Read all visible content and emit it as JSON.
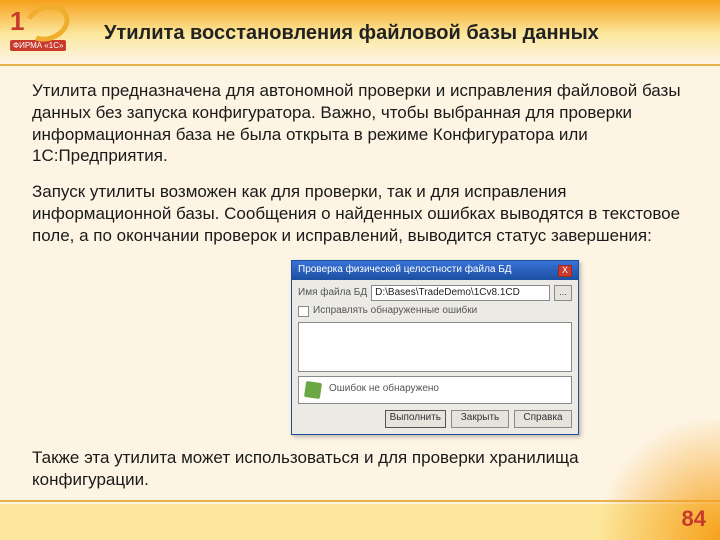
{
  "logo": {
    "brand": "ФИРМА «1С»"
  },
  "title": "Утилита восстановления файловой базы данных",
  "paragraphs": {
    "p1": "Утилита предназначена для автономной проверки и исправления файловой базы данных без запуска конфигуратора. Важно, чтобы выбранная для проверки информационная база не была открыта в режиме Конфигуратора или 1С:Предприятия.",
    "p2": "Запуск утилиты возможен как для проверки, так и для исправления информационной базы. Сообщения о найденных ошибках выводятся в текстовое поле, а по окончании проверок и исправлений, выводится статус завершения:",
    "p3": "Также эта утилита может использоваться и для проверки хранилища конфигурации."
  },
  "window": {
    "title": "Проверка физической целостности файла БД",
    "close": "X",
    "file_label": "Имя файла БД",
    "file_value": "D:\\Bases\\TradeDemo\\1Cv8.1CD",
    "browse": "...",
    "checkbox_label": "Исправлять обнаруженные ошибки",
    "status_text": "Ошибок не обнаружено",
    "buttons": {
      "run": "Выполнить",
      "close": "Закрыть",
      "help": "Справка"
    }
  },
  "page_number": "84"
}
